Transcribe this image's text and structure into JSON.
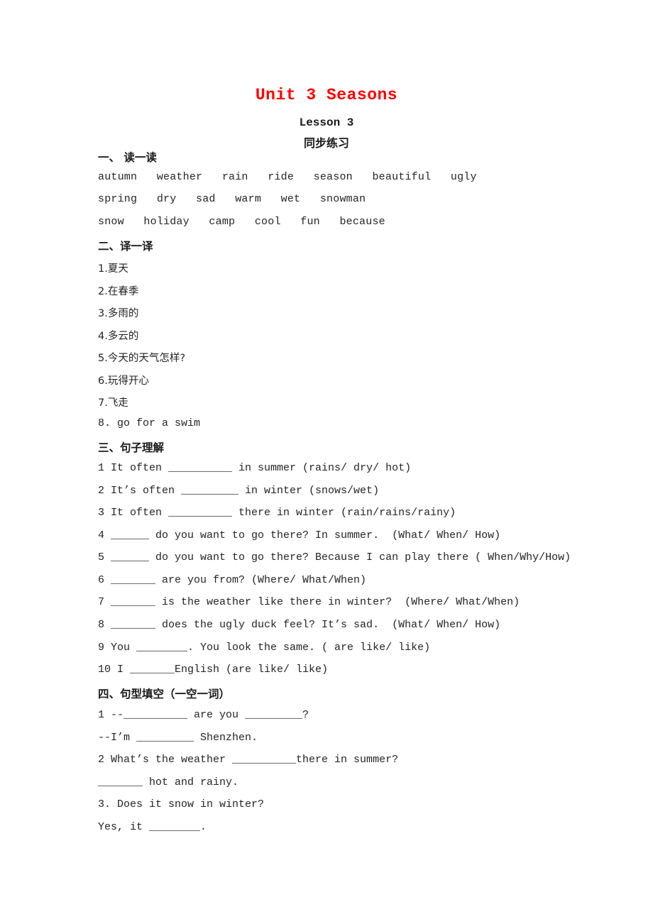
{
  "document": {
    "title": "Unit 3 Seasons",
    "subtitle_lesson": "Lesson 3",
    "subtitle_cn": "同步练习",
    "title_color": "#ff0000",
    "text_color": "#242424",
    "background": "#ffffff"
  },
  "section1": {
    "heading": "一、 读一读",
    "lines": [
      "autumn   weather   rain   ride   season   beautiful   ugly",
      "spring   dry   sad   warm   wet   snowman",
      "snow   holiday   camp   cool   fun   because"
    ]
  },
  "section2": {
    "heading": "二、译一译",
    "items": [
      "1.夏天",
      "2.在春季",
      "3.多雨的",
      "4.多云的",
      "5.今天的天气怎样?",
      "6.玩得开心",
      "7.飞走",
      "8. go for a swim"
    ]
  },
  "section3": {
    "heading": "三、句子理解",
    "items": [
      "1 It often __________ in summer (rains/ dry/ hot)",
      "2 It’s often _________ in winter (snows/wet)",
      "3 It often __________ there in winter (rain/rains/rainy)",
      "4 ______ do you want to go there? In summer.  (What/ When/ How)",
      "5 ______ do you want to go there? Because I can play there ( When/Why/How)",
      "6 _______ are you from? (Where/ What/When)",
      "7 _______ is the weather like there in winter?  (Where/ What/When)",
      "8 _______ does the ugly duck feel? It’s sad.  (What/ When/ How)",
      "9 You ________. You look the same. ( are like/ like)",
      "10 I _______English (are like/ like)"
    ]
  },
  "section4": {
    "heading": "四、句型填空（一空一词）",
    "items": [
      "1 --__________ are you _________?",
      "--I’m _________ Shenzhen.",
      "2 What’s the weather __________there in summer?",
      "_______ hot and rainy.",
      "3. Does it snow in winter?",
      "Yes, it ________."
    ]
  }
}
